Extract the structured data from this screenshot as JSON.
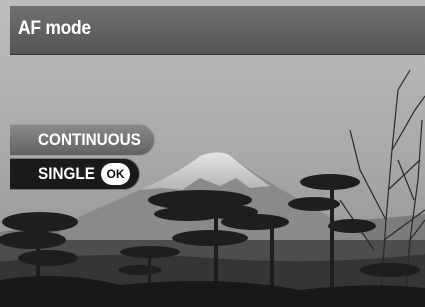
{
  "header": {
    "title": "AF mode"
  },
  "menu": {
    "options": [
      {
        "label": "CONTINUOUS",
        "selected": false
      },
      {
        "label": "SINGLE",
        "selected": true,
        "badge": "OK"
      }
    ]
  },
  "colors": {
    "title_bar": "#606060",
    "option_unselected": "#777777",
    "option_selected": "#1a1a1a",
    "text": "#ffffff"
  }
}
